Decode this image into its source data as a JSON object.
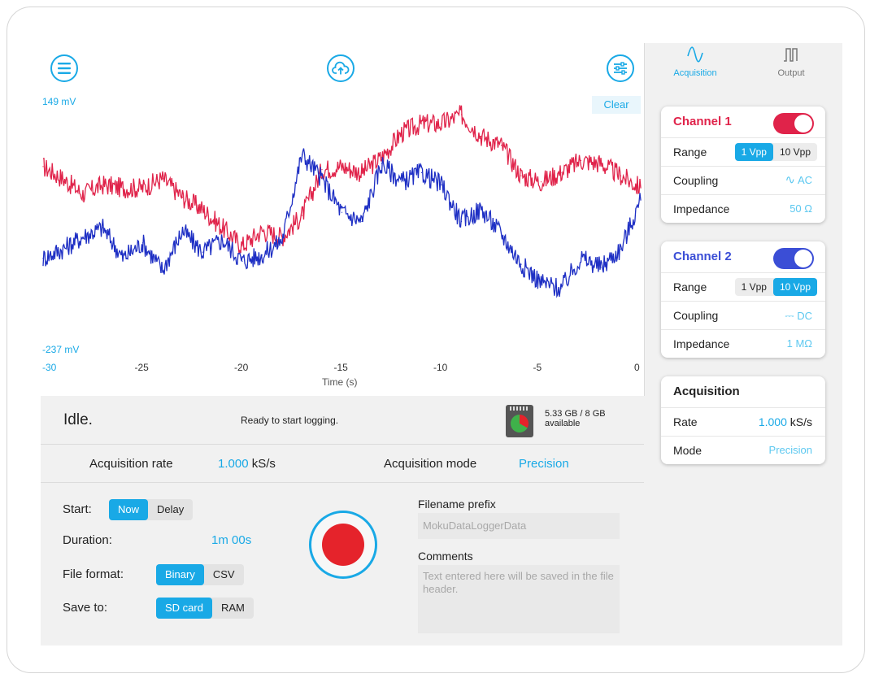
{
  "toolbar": {
    "y_max_label": "149 mV",
    "y_min_label": "-237 mV",
    "clear_label": "Clear"
  },
  "chart_data": {
    "type": "line",
    "xlabel": "Time (s)",
    "x_ticks": [
      "-30",
      "-25",
      "-20",
      "-15",
      "-10",
      "-5",
      "0"
    ],
    "xlim": [
      -30,
      0
    ],
    "ylim": [
      -237,
      149
    ],
    "y_unit": "mV",
    "grid": false,
    "series": [
      {
        "color": "#e0234a",
        "x": [
          -30,
          -29,
          -28,
          -27,
          -26,
          -25,
          -24,
          -23,
          -22,
          -21,
          -20,
          -19,
          -18,
          -17,
          -16,
          -15,
          -14,
          -13,
          -12,
          -11,
          -10,
          -9,
          -8,
          -7,
          -6,
          -5,
          -4,
          -3,
          -2,
          -1,
          0
        ],
        "values": [
          40,
          20,
          -5,
          10,
          5,
          5,
          20,
          -10,
          -30,
          -60,
          -90,
          -65,
          -75,
          -40,
          35,
          40,
          30,
          55,
          95,
          110,
          110,
          125,
          90,
          75,
          25,
          15,
          30,
          50,
          45,
          25,
          5
        ]
      },
      {
        "color": "#1e2fc4",
        "x": [
          -30,
          -29,
          -28,
          -27,
          -26,
          -25,
          -24,
          -23,
          -22,
          -21,
          -20,
          -19,
          -18,
          -17,
          -16,
          -15,
          -14,
          -13,
          -12,
          -11,
          -10,
          -9,
          -8,
          -7,
          -6,
          -5,
          -4,
          -3,
          -2,
          -1,
          0
        ],
        "values": [
          -110,
          -95,
          -75,
          -60,
          -110,
          -85,
          -130,
          -65,
          -100,
          -80,
          -115,
          -105,
          -80,
          60,
          20,
          -35,
          -50,
          45,
          15,
          30,
          10,
          -50,
          -30,
          -70,
          -120,
          -150,
          -160,
          -110,
          -125,
          -95,
          -15
        ]
      }
    ]
  },
  "sidebar": {
    "tab_acquisition": "Acquisition",
    "tab_output": "Output",
    "channel1": {
      "title": "Channel 1",
      "color": "#e0234a",
      "range_label": "Range",
      "range_options": [
        "1 Vpp",
        "10 Vpp"
      ],
      "range_selected": "1 Vpp",
      "coupling_label": "Coupling",
      "coupling_value": "AC",
      "impedance_label": "Impedance",
      "impedance_value": "50 Ω"
    },
    "channel2": {
      "title": "Channel 2",
      "color": "#3b4ed6",
      "range_label": "Range",
      "range_options": [
        "1 Vpp",
        "10 Vpp"
      ],
      "range_selected": "10 Vpp",
      "coupling_label": "Coupling",
      "coupling_value": "DC",
      "impedance_label": "Impedance",
      "impedance_value": "1 MΩ"
    },
    "acquisition": {
      "title": "Acquisition",
      "rate_label": "Rate",
      "rate_number": "1.000",
      "rate_unit": "kS/s",
      "mode_label": "Mode",
      "mode_value": "Precision"
    }
  },
  "status": {
    "state": "Idle.",
    "message": "Ready to start logging.",
    "storage_line1": "5.33 GB / 8 GB",
    "storage_line2": "available",
    "storage_used_fraction": 0.33
  },
  "rate_bar": {
    "rate_label": "Acquisition rate",
    "rate_number": "1.000",
    "rate_unit": "kS/s",
    "mode_label": "Acquisition mode",
    "mode_value": "Precision"
  },
  "logging": {
    "start_label": "Start:",
    "start_options": [
      "Now",
      "Delay"
    ],
    "start_selected": "Now",
    "duration_label": "Duration:",
    "duration_value": "1m 00s",
    "format_label": "File format:",
    "format_options": [
      "Binary",
      "CSV"
    ],
    "format_selected": "Binary",
    "save_label": "Save to:",
    "save_options": [
      "SD card",
      "RAM"
    ],
    "save_selected": "SD card",
    "prefix_label": "Filename prefix",
    "prefix_placeholder": "MokuDataLoggerData",
    "comments_label": "Comments",
    "comments_placeholder": "Text entered here will be saved in the file header."
  }
}
